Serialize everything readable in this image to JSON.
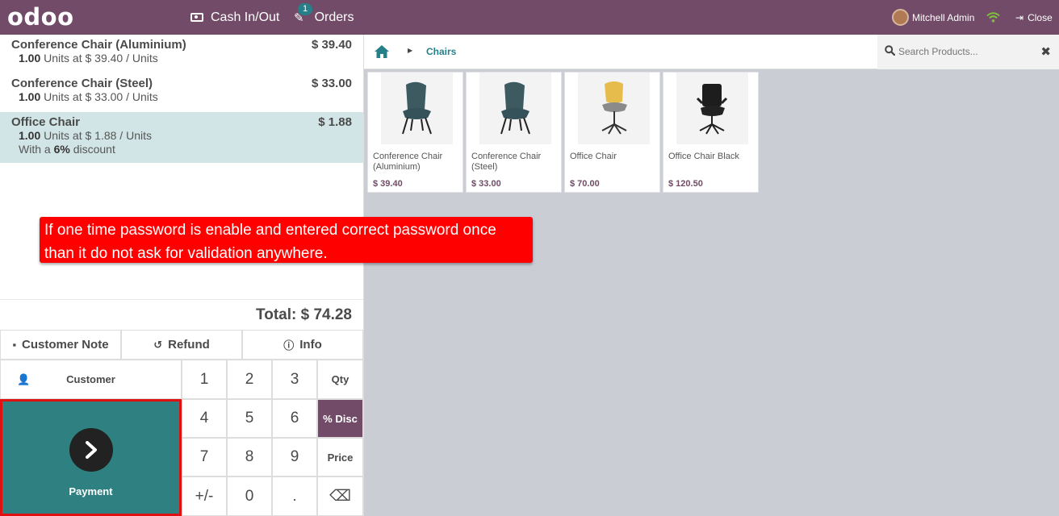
{
  "topbar": {
    "logo": "odoo",
    "cash_label": "Cash In/Out",
    "orders_label": "Orders",
    "orders_badge": "1",
    "user_name": "Mitchell Admin",
    "close_label": "Close"
  },
  "order": {
    "lines": [
      {
        "name": "Conference Chair (Aluminium)",
        "price": "$ 39.40",
        "qty": "1.00",
        "unit_text": "Units at $ 39.40 / Units",
        "discount_prefix": "",
        "discount": "",
        "discount_suffix": ""
      },
      {
        "name": "Conference Chair (Steel)",
        "price": "$ 33.00",
        "qty": "1.00",
        "unit_text": "Units at $ 33.00 / Units",
        "discount_prefix": "",
        "discount": "",
        "discount_suffix": ""
      },
      {
        "name": "Office Chair",
        "price": "$ 1.88",
        "qty": "1.00",
        "unit_text": "Units at $ 1.88 / Units",
        "discount_prefix": "With a",
        "discount": "6%",
        "discount_suffix": "discount"
      }
    ],
    "total": "Total: $ 74.28"
  },
  "controls": {
    "customer_note": "Customer Note",
    "refund": "Refund",
    "info": "Info",
    "customer": "Customer",
    "payment": "Payment"
  },
  "numpad": {
    "k1": "1",
    "k2": "2",
    "k3": "3",
    "qty": "Qty",
    "k4": "4",
    "k5": "5",
    "k6": "6",
    "disc": "% Disc",
    "k7": "7",
    "k8": "8",
    "k9": "9",
    "price": "Price",
    "plusminus": "+/-",
    "k0": "0",
    "dot": ".",
    "backspace": "⌫",
    "active_mode": "% Disc"
  },
  "breadcrumb": {
    "category": "Chairs"
  },
  "search": {
    "placeholder": "Search Products..."
  },
  "products": [
    {
      "name": "Conference Chair (Aluminium)",
      "price": "$ 39.40"
    },
    {
      "name": "Conference Chair (Steel)",
      "price": "$ 33.00"
    },
    {
      "name": "Office Chair",
      "price": "$ 70.00"
    },
    {
      "name": "Office Chair Black",
      "price": "$ 120.50"
    }
  ],
  "annotation": {
    "text": "If one time password is enable and entered correct password once than it do not ask for validation anywhere."
  },
  "colors": {
    "brand": "#714b67",
    "accent": "#26808a",
    "payment": "#2f8080",
    "callout": "#ff0000"
  }
}
